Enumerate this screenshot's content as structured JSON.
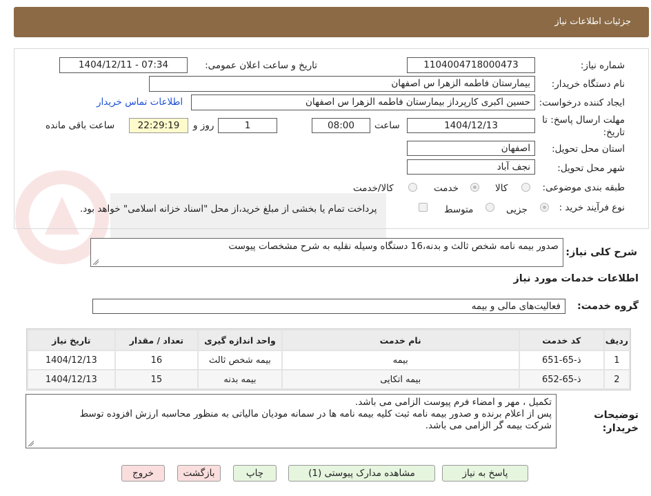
{
  "header": {
    "title": "جزئیات اطلاعات نیاز"
  },
  "fields": {
    "need_number": {
      "label": "شماره نیاز:",
      "value": "1104004718000473"
    },
    "announce_datetime": {
      "label": "تاریخ و ساعت اعلان عمومی:",
      "value": "1404/12/11 - 07:34"
    },
    "buyer_org": {
      "label": "نام دستگاه خریدار:",
      "value": "بیمارستان فاطمه الزهرا س  اصفهان"
    },
    "requester": {
      "label": "ایجاد کننده درخواست:",
      "value": "حسین اکبری کارپرداز بیمارستان فاطمه الزهرا س  اصفهان"
    },
    "buyer_contact_link": "اطلاعات تماس خریدار",
    "deadline": {
      "label_line1": "مهلت ارسال پاسخ: تا",
      "label_line2": "تاریخ:",
      "date": "1404/12/13",
      "time_label": "ساعت",
      "time": "08:00",
      "days": "1",
      "days_label": "روز و",
      "remaining": "22:29:19",
      "remaining_label": "ساعت باقی مانده"
    },
    "delivery_province": {
      "label": "استان محل تحویل:",
      "value": "اصفهان"
    },
    "delivery_city": {
      "label": "شهر محل تحویل:",
      "value": "نجف آباد"
    },
    "subject_class": {
      "label": "طبقه بندی موضوعی:",
      "options": [
        "کالا",
        "خدمت",
        "کالا/خدمت"
      ],
      "selected": "خدمت"
    },
    "purchase_type": {
      "label": "نوع فرآیند خرید :",
      "options": [
        "جزیی",
        "متوسط"
      ],
      "selected": "جزیی",
      "payment_note": "پرداخت تمام یا بخشی از مبلغ خرید،از محل \"اسناد خزانه اسلامی\" خواهد بود."
    }
  },
  "general_description": {
    "label": "شرح کلی نیاز:",
    "value": "صدور بیمه نامه شخص ثالث و بدنه،16 دستگاه وسیله نقلیه به شرح مشخصات پیوست"
  },
  "services_section_title": "اطلاعات خدمات مورد نیاز",
  "service_group": {
    "label": "گروه خدمت:",
    "value": "فعالیت‌های مالی و بیمه"
  },
  "table": {
    "headers": [
      "ردیف",
      "کد خدمت",
      "نام خدمت",
      "واحد اندازه گیری",
      "تعداد / مقدار",
      "تاریخ نیاز"
    ],
    "rows": [
      [
        "1",
        "ذ-65-651",
        "بیمه",
        "بیمه شخص ثالث",
        "16",
        "1404/12/13"
      ],
      [
        "2",
        "ذ-65-652",
        "بیمه اتکایی",
        "بیمه بدنه",
        "15",
        "1404/12/13"
      ]
    ]
  },
  "buyer_notes": {
    "label_line1": "توضیحات",
    "label_line2": "خریدار:",
    "line1": "تکمیل ، مهر و امضاء فرم پیوست الزامی می باشد.",
    "line2": "پس از اعلام برنده و صدور بیمه نامه ثبت کلیه بیمه نامه ها در سمانه مودیان مالیاتی به منظور محاسبه ارزش افزوده توسط",
    "line3": "شرکت بیمه گر الزامی می باشد."
  },
  "buttons": {
    "respond": "پاسخ به نیاز",
    "view_docs": "مشاهده مدارک پیوستی (1)",
    "print": "چاپ",
    "back": "بازگشت",
    "exit": "خروج"
  },
  "colors": {
    "header_bg": "#8b6a45",
    "link": "#1a4fd6",
    "button_green": "#e6f5de",
    "button_red": "#fadedd"
  }
}
